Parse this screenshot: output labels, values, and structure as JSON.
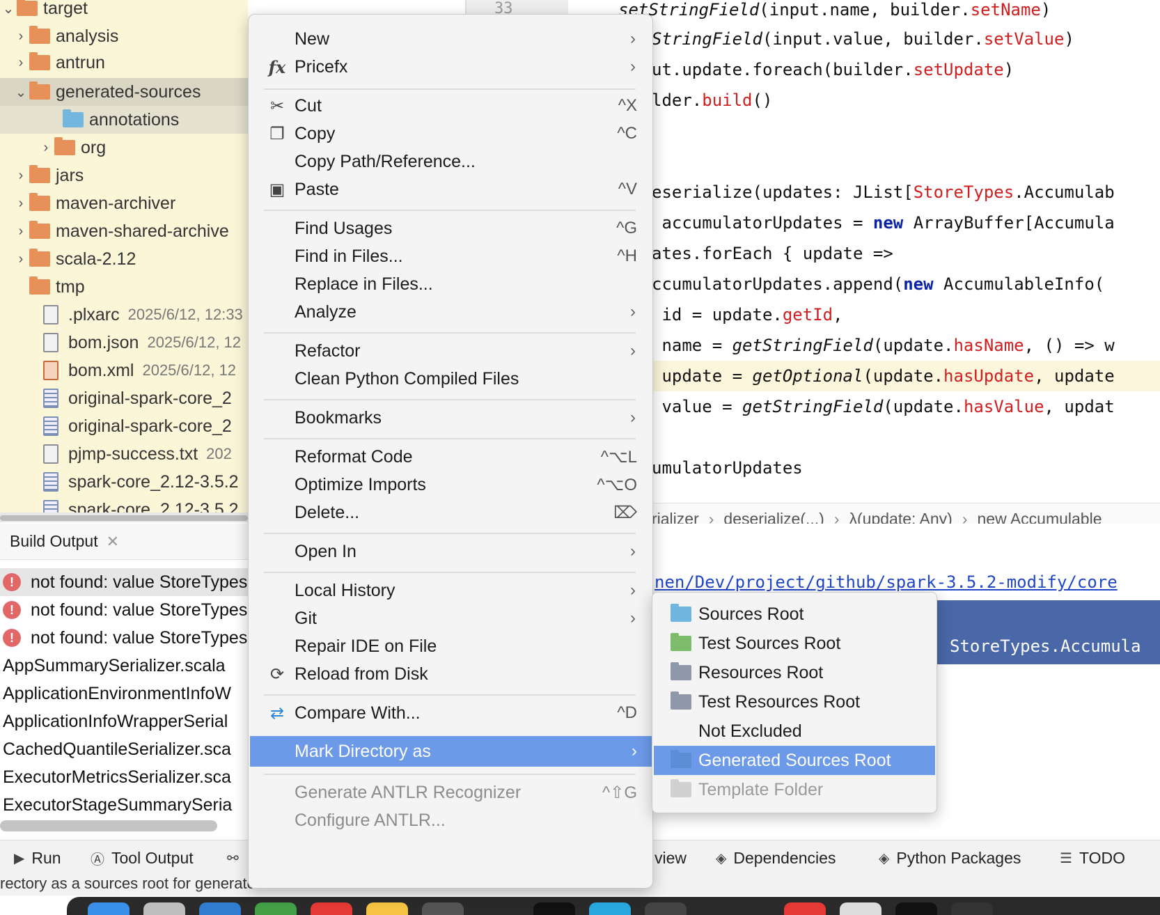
{
  "tree": {
    "items": [
      {
        "label": "target",
        "meta": ""
      },
      {
        "label": "analysis",
        "meta": ""
      },
      {
        "label": "antrun",
        "meta": ""
      },
      {
        "label": "generated-sources",
        "meta": ""
      },
      {
        "label": "annotations",
        "meta": ""
      },
      {
        "label": "org",
        "meta": ""
      },
      {
        "label": "jars",
        "meta": ""
      },
      {
        "label": "maven-archiver",
        "meta": ""
      },
      {
        "label": "maven-shared-archive",
        "meta": ""
      },
      {
        "label": "scala-2.12",
        "meta": ""
      },
      {
        "label": "tmp",
        "meta": ""
      },
      {
        "label": ".plxarc",
        "meta": "2025/6/12, 12:33"
      },
      {
        "label": "bom.json",
        "meta": "2025/6/12, 12"
      },
      {
        "label": "bom.xml",
        "meta": "2025/6/12, 12"
      },
      {
        "label": "original-spark-core_2",
        "meta": ""
      },
      {
        "label": "original-spark-core_2",
        "meta": ""
      },
      {
        "label": "pjmp-success.txt",
        "meta": "202"
      },
      {
        "label": "spark-core_2.12-3.5.2",
        "meta": ""
      },
      {
        "label": "spark-core_2.12-3.5.2",
        "meta": ""
      }
    ]
  },
  "gutter": {
    "line": "33"
  },
  "editor": {
    "lines": [
      {
        "a": "setStringField",
        "b": "(input.name, builder.",
        "c": "setName",
        "d": ")"
      },
      {
        "a": "StringField",
        "b": "(input.value, builder.",
        "c": "setValue",
        "d": ")"
      },
      {
        "a": "",
        "b": "ut.update.foreach(builder.",
        "c": "setUpdate",
        "d": ")"
      },
      {
        "a": "",
        "b": "lder.",
        "c": "build",
        "d": "()"
      },
      {
        "a": "",
        "b": "eserialize(updates: JList[",
        "c": "StoreTypes",
        "d": ".Accumulab"
      },
      {
        "a": "",
        "b": " accumulatorUpdates = ",
        "k": "new",
        "d": " ArrayBuffer[Accumula"
      },
      {
        "a": "",
        "b": "ates.forEach { update =>",
        "c": "",
        "d": ""
      },
      {
        "a": "",
        "b": "ccumulatorUpdates.append(",
        "k": "new",
        "d": " AccumulableInfo("
      },
      {
        "a": "",
        "b": " id = update.",
        "c": "getId",
        "d": ","
      },
      {
        "a": "",
        "b": " name = ",
        "i": "getStringField",
        "b2": "(update.",
        "c": "hasName",
        "d": ", () => w"
      },
      {
        "a": "",
        "b": " update = ",
        "i": "getOptional",
        "b2": "(update.",
        "c": "hasUpdate",
        "d": ", update"
      },
      {
        "a": "",
        "b": " value = ",
        "i": "getStringField",
        "b2": "(update.",
        "c": "hasValue",
        "d": ", updat"
      },
      {
        "a": "",
        "b": "umulatorUpdates",
        "c": "",
        "d": ""
      }
    ]
  },
  "breadcrumbs": [
    "rializer",
    "deserialize(...)",
    "λ(update: Any)",
    "new Accumulable"
  ],
  "build": {
    "tab_label": "Build Output",
    "rows": [
      {
        "text": "not found: value StoreTypes",
        "error": true
      },
      {
        "text": "not found: value StoreTypes",
        "error": true
      },
      {
        "text": "not found: value StoreTypes",
        "error": true
      },
      {
        "text": "AppSummarySerializer.scala",
        "error": false
      },
      {
        "text": "ApplicationEnvironmentInfoW",
        "error": false
      },
      {
        "text": "ApplicationInfoWrapperSerial",
        "error": false
      },
      {
        "text": "CachedQuantileSerializer.sca",
        "error": false
      },
      {
        "text": "ExecutorMetricsSerializer.sca",
        "error": false
      },
      {
        "text": "ExecutorStageSummarySeria",
        "error": false
      }
    ],
    "path_text": "nen/Dev/project/github/spark-3.5.2-modify/core",
    "highlight_text": "StoreTypes.Accumula"
  },
  "menu": {
    "items": [
      {
        "label": "New",
        "shortcut": "",
        "arrow": true,
        "icon": ""
      },
      {
        "label": "Pricefx",
        "shortcut": "",
        "arrow": true,
        "icon": "fx-icon"
      },
      {
        "label": "Cut",
        "shortcut": "^X",
        "arrow": false,
        "icon": "scissors-icon"
      },
      {
        "label": "Copy",
        "shortcut": "^C",
        "arrow": false,
        "icon": "copy-icon"
      },
      {
        "label": "Copy Path/Reference...",
        "shortcut": "",
        "arrow": false,
        "icon": ""
      },
      {
        "label": "Paste",
        "shortcut": "^V",
        "arrow": false,
        "icon": "clipboard-icon"
      },
      {
        "label": "Find Usages",
        "shortcut": "^G",
        "arrow": false,
        "icon": ""
      },
      {
        "label": "Find in Files...",
        "shortcut": "^H",
        "arrow": false,
        "icon": ""
      },
      {
        "label": "Replace in Files...",
        "shortcut": "",
        "arrow": false,
        "icon": ""
      },
      {
        "label": "Analyze",
        "shortcut": "",
        "arrow": true,
        "icon": ""
      },
      {
        "label": "Refactor",
        "shortcut": "",
        "arrow": true,
        "icon": ""
      },
      {
        "label": "Clean Python Compiled Files",
        "shortcut": "",
        "arrow": false,
        "icon": ""
      },
      {
        "label": "Bookmarks",
        "shortcut": "",
        "arrow": true,
        "icon": ""
      },
      {
        "label": "Reformat Code",
        "shortcut": "^⌥L",
        "arrow": false,
        "icon": ""
      },
      {
        "label": "Optimize Imports",
        "shortcut": "^⌥O",
        "arrow": false,
        "icon": ""
      },
      {
        "label": "Delete...",
        "shortcut": "⌦",
        "arrow": false,
        "icon": ""
      },
      {
        "label": "Open In",
        "shortcut": "",
        "arrow": true,
        "icon": ""
      },
      {
        "label": "Local History",
        "shortcut": "",
        "arrow": true,
        "icon": ""
      },
      {
        "label": "Git",
        "shortcut": "",
        "arrow": true,
        "icon": ""
      },
      {
        "label": "Repair IDE on File",
        "shortcut": "",
        "arrow": false,
        "icon": ""
      },
      {
        "label": "Reload from Disk",
        "shortcut": "",
        "arrow": false,
        "icon": "reload-icon"
      },
      {
        "label": "Compare With...",
        "shortcut": "^D",
        "arrow": false,
        "icon": "compare-icon"
      },
      {
        "label": "Mark Directory as",
        "shortcut": "",
        "arrow": true,
        "icon": ""
      },
      {
        "label": "Generate ANTLR Recognizer",
        "shortcut": "^⇧G",
        "arrow": false,
        "icon": ""
      },
      {
        "label": "Configure ANTLR...",
        "shortcut": "",
        "arrow": false,
        "icon": ""
      }
    ]
  },
  "submenu": {
    "items": [
      {
        "label": "Sources Root",
        "color": "#6fb6e0"
      },
      {
        "label": "Test Sources Root",
        "color": "#7cbc6b"
      },
      {
        "label": "Resources Root",
        "color": "#8e98a8"
      },
      {
        "label": "Test Resources Root",
        "color": "#8e98a8"
      },
      {
        "label": "Not Excluded",
        "color": ""
      },
      {
        "label": "Generated Sources Root",
        "color": "#5a8fd6"
      },
      {
        "label": "Template Folder",
        "color": "#d0d0d0"
      }
    ]
  },
  "toolbar": {
    "items": [
      {
        "label": "Run"
      },
      {
        "label": "Tool Output"
      },
      {
        "label": "view"
      },
      {
        "label": "Dependencies"
      },
      {
        "label": "Python Packages"
      },
      {
        "label": "TODO"
      }
    ]
  },
  "status": {
    "text": "rectory as a sources root for generated files"
  }
}
